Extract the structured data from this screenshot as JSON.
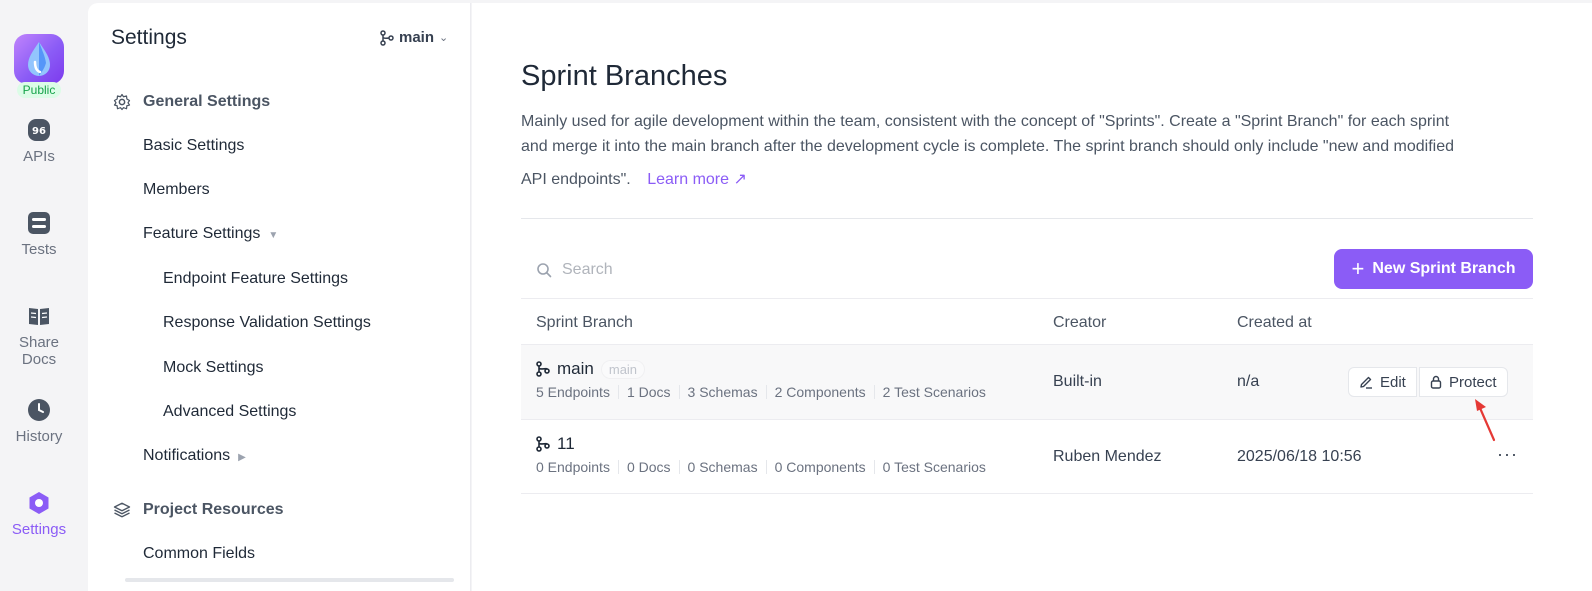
{
  "rail": {
    "badge": "Public",
    "items": [
      {
        "label": "APIs",
        "icon": "api-icon"
      },
      {
        "label": "Tests",
        "icon": "tests-icon"
      },
      {
        "label": "Share Docs",
        "icon": "book-icon"
      },
      {
        "label": "History",
        "icon": "clock-icon"
      },
      {
        "label": "Settings",
        "icon": "settings-icon",
        "active": true
      }
    ]
  },
  "panel": {
    "title": "Settings",
    "branch": "main",
    "general_label": "General Settings",
    "items": {
      "basic": "Basic Settings",
      "members": "Members",
      "feature": "Feature Settings",
      "endpoint_feature": "Endpoint Feature Settings",
      "response_validation": "Response Validation Settings",
      "mock": "Mock Settings",
      "advanced": "Advanced Settings",
      "notifications": "Notifications"
    },
    "project_resources_label": "Project Resources",
    "common_fields": "Common Fields"
  },
  "main": {
    "title": "Sprint Branches",
    "desc_line1": "Mainly used for agile development within the team, consistent with the concept of \"Sprints\". Create a \"Sprint Branch\" for each sprint",
    "desc_line2": "and merge it into the main branch after the development cycle is complete. The sprint branch should only include \"new and modified",
    "desc_line3": "API endpoints\".",
    "learn_more": "Learn more ↗",
    "search_placeholder": "Search",
    "new_button": "New Sprint Branch",
    "columns": {
      "branch": "Sprint Branch",
      "creator": "Creator",
      "created_at": "Created at"
    },
    "rows": [
      {
        "name": "main",
        "tag": "main",
        "stats": [
          "5 Endpoints",
          "1 Docs",
          "3 Schemas",
          "2 Components",
          "2 Test Scenarios"
        ],
        "creator": "Built-in",
        "created_at": "n/a",
        "edit": "Edit",
        "protect": "Protect"
      },
      {
        "name": "11",
        "stats": [
          "0 Endpoints",
          "0 Docs",
          "0 Schemas",
          "0 Components",
          "0 Test Scenarios"
        ],
        "creator": "Ruben Mendez",
        "created_at": "2025/06/18 10:56",
        "more": "···"
      }
    ]
  },
  "colors": {
    "accent": "#8b5cf6",
    "annotation_arrow": "#e53935",
    "public_badge": "#16a34a"
  }
}
